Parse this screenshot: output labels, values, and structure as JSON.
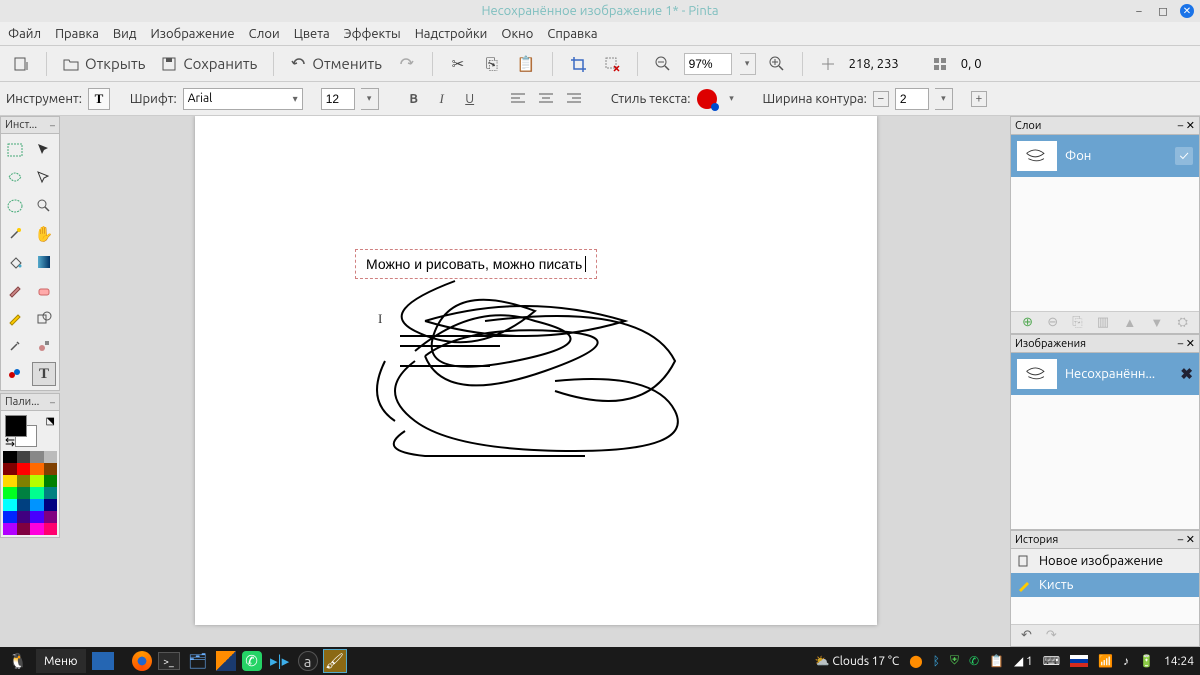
{
  "titlebar": {
    "title": "Несохранённое изображение 1* - Pinta"
  },
  "menubar": [
    "Файл",
    "Правка",
    "Вид",
    "Изображение",
    "Слои",
    "Цвета",
    "Эффекты",
    "Надстройки",
    "Окно",
    "Справка"
  ],
  "toolbar1": {
    "open": "Открыть",
    "save": "Сохранить",
    "undo": "Отменить",
    "zoom_value": "97%",
    "coords": "218, 233",
    "size": "0, 0"
  },
  "toolbar2": {
    "instrument_label": "Инструмент:",
    "font_label": "Шрифт:",
    "font_name": "Arial",
    "font_size": "12",
    "text_style_label": "Стиль текста:",
    "outline_label": "Ширина контура:",
    "outline_width": "2"
  },
  "left": {
    "tools_title": "Инст...",
    "palette_title": "Пали..."
  },
  "canvas": {
    "text_content": "Можно и рисовать, можно писать"
  },
  "right": {
    "layers_title": "Слои",
    "layer_name": "Фон",
    "images_title": "Изображения",
    "image_name": "Несохранённ...",
    "history_title": "История",
    "history_items": [
      "Новое изображение",
      "Кисть"
    ]
  },
  "taskbar": {
    "menu": "Меню",
    "weather": "Clouds 17 °C",
    "notif": "1",
    "time": "14:24"
  }
}
